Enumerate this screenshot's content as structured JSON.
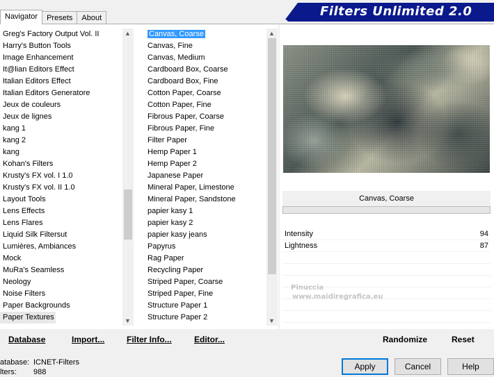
{
  "tabs": [
    "Navigator",
    "Presets",
    "About"
  ],
  "banner_title": "Filters Unlimited 2.0",
  "categories": [
    "Greg's Factory Output Vol. II",
    "Harry's Button Tools",
    "Image Enhancement",
    "It@lian Editors Effect",
    "Italian Editors Effect",
    "Italian Editors Generatore",
    "Jeux de couleurs",
    "Jeux de lignes",
    "kang 1",
    "kang 2",
    "kang",
    "Kohan's Filters",
    "Krusty's FX vol. I 1.0",
    "Krusty's FX vol. II 1.0",
    "Layout Tools",
    "Lens Effects",
    "Lens Flares",
    "Liquid Silk Filtersut",
    "Lumières, Ambiances",
    "Mock",
    "MuRa's Seamless",
    "Neology",
    "Noise Filters",
    "Paper Backgrounds",
    "Paper Textures"
  ],
  "filters": [
    "Canvas, Coarse",
    "Canvas, Fine",
    "Canvas, Medium",
    "Cardboard Box, Coarse",
    "Cardboard Box, Fine",
    "Cotton Paper, Coarse",
    "Cotton Paper, Fine",
    "Fibrous Paper, Coarse",
    "Fibrous Paper, Fine",
    "Filter Paper",
    "Hemp Paper 1",
    "Hemp Paper 2",
    "Japanese Paper",
    "Mineral Paper, Limestone",
    "Mineral Paper, Sandstone",
    "papier kasy 1",
    "papier kasy 2",
    "papier kasy jeans",
    "Papyrus",
    "Rag Paper",
    "Recycling Paper",
    "Striped Paper, Coarse",
    "Striped Paper, Fine",
    "Structure Paper 1",
    "Structure Paper 2"
  ],
  "selected_filter": "Canvas, Coarse",
  "params": [
    {
      "label": "Intensity",
      "value": "94"
    },
    {
      "label": "Lightness",
      "value": "87"
    }
  ],
  "watermark": {
    "line1": "Pinuccia",
    "line2": "www.maidiregrafica.eu"
  },
  "toolbar": {
    "database": "Database",
    "import": "Import...",
    "filter_info": "Filter Info...",
    "editor": "Editor...",
    "randomize": "Randomize",
    "reset": "Reset"
  },
  "status": {
    "database_label": "atabase:",
    "database_value": "ICNET-Filters",
    "filters_label": "lters:",
    "filters_value": "988"
  },
  "buttons": {
    "apply": "Apply",
    "cancel": "Cancel",
    "help": "Help"
  }
}
